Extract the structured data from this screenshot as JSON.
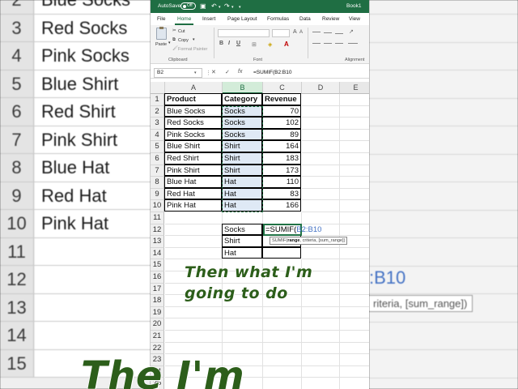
{
  "background": {
    "left_rows": [
      {
        "num": "2",
        "text": "Blue Socks"
      },
      {
        "num": "3",
        "text": "Red Socks"
      },
      {
        "num": "4",
        "text": "Pink Socks"
      },
      {
        "num": "5",
        "text": "Blue Shirt"
      },
      {
        "num": "6",
        "text": "Red Shirt"
      },
      {
        "num": "7",
        "text": "Pink Shirt"
      },
      {
        "num": "8",
        "text": "Blue Hat"
      },
      {
        "num": "9",
        "text": "Red Hat"
      },
      {
        "num": "10",
        "text": "Pink Hat"
      },
      {
        "num": "11",
        "text": ""
      },
      {
        "num": "12",
        "text": ""
      },
      {
        "num": "13",
        "text": ""
      },
      {
        "num": "14",
        "text": ""
      },
      {
        "num": "15",
        "text": ""
      }
    ],
    "right_formula_fragment": ":B10",
    "right_tooltip_fragment": "riteria, [sum_range])"
  },
  "titlebar": {
    "autosave_label": "AutoSave",
    "autosave_state": "Off",
    "document_name": "Book1"
  },
  "menu": [
    "File",
    "Home",
    "Insert",
    "Page Layout",
    "Formulas",
    "Data",
    "Review",
    "View"
  ],
  "ribbon": {
    "paste": "Paste",
    "cut": "Cut",
    "copy": "Copy",
    "format_painter": "Format Painter",
    "clipboard_group": "Clipboard",
    "font_group": "Font",
    "alignment_group": "Alignment"
  },
  "formula_bar": {
    "name_box": "B2",
    "cancel": "✕",
    "enter": "✓",
    "fx": "fx",
    "formula": "=SUMIF(B2:B10"
  },
  "sheet": {
    "columns": [
      "A",
      "B",
      "C",
      "D",
      "E"
    ],
    "rows": [
      "1",
      "2",
      "3",
      "4",
      "5",
      "6",
      "7",
      "8",
      "9",
      "10",
      "11",
      "12",
      "13",
      "14",
      "15",
      "16",
      "17",
      "18",
      "19",
      "20",
      "21",
      "22",
      "23",
      "24",
      "25"
    ],
    "headers": {
      "a": "Product",
      "b": "Category",
      "c": "Revenue"
    },
    "table": [
      {
        "product": "Blue Socks",
        "category": "Socks",
        "revenue": "70"
      },
      {
        "product": "Red Socks",
        "category": "Socks",
        "revenue": "102"
      },
      {
        "product": "Pink Socks",
        "category": "Socks",
        "revenue": "89"
      },
      {
        "product": "Blue Shirt",
        "category": "Shirt",
        "revenue": "164"
      },
      {
        "product": "Red Shirt",
        "category": "Shirt",
        "revenue": "183"
      },
      {
        "product": "Pink Shirt",
        "category": "Shirt",
        "revenue": "173"
      },
      {
        "product": "Blue Hat",
        "category": "Hat",
        "revenue": "110"
      },
      {
        "product": "Red Hat",
        "category": "Hat",
        "revenue": "83"
      },
      {
        "product": "Pink Hat",
        "category": "Hat",
        "revenue": "166"
      }
    ],
    "summary": [
      "Socks",
      "Shirt",
      "Hat"
    ],
    "edit_prefix": "=SUMIF(",
    "edit_ref": "B2:B10",
    "tooltip_fn": "SUMIF(",
    "tooltip_arg": "range",
    "tooltip_rest": ", criteria, [sum_range])"
  },
  "caption": {
    "line1": "Then what I'm",
    "line2": "going to do",
    "big": "The      I'm"
  },
  "colors": {
    "excel_green": "#1f6e43",
    "marquee": "#217346",
    "caption_green": "#2c5e1a",
    "reference_blue": "#4472c4"
  }
}
